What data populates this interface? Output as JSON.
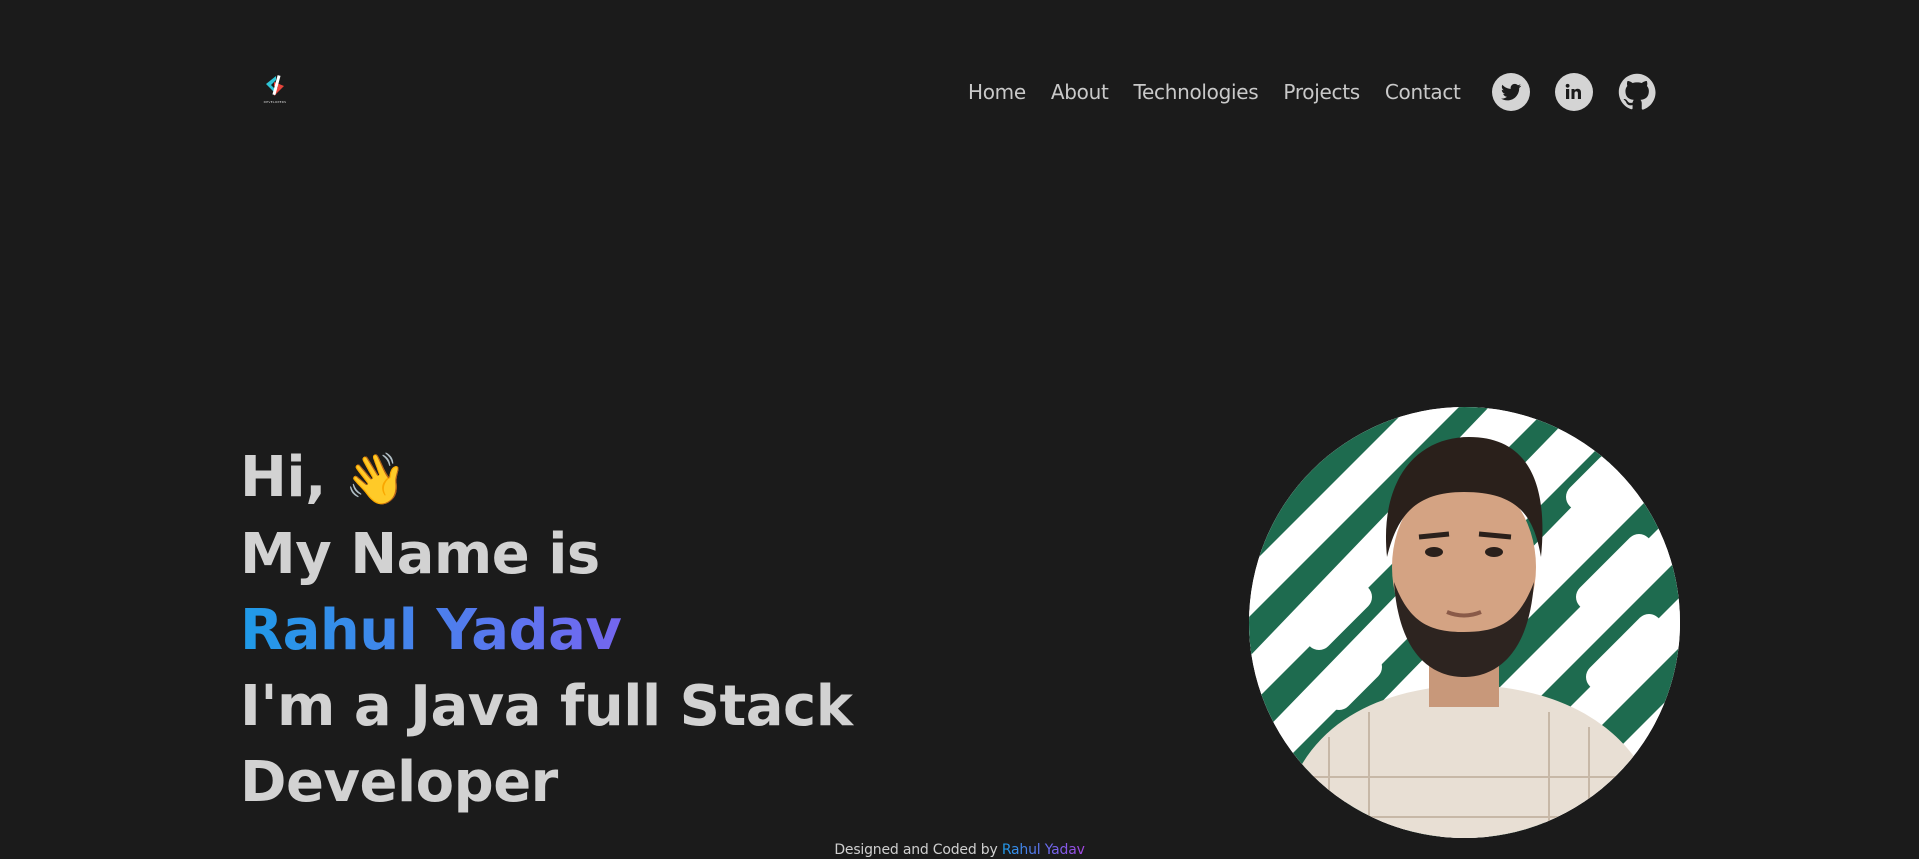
{
  "header": {
    "logo_text": "DEVELOPERS",
    "nav": [
      {
        "label": "Home"
      },
      {
        "label": "About"
      },
      {
        "label": "Technologies"
      },
      {
        "label": "Projects"
      },
      {
        "label": "Contact"
      }
    ],
    "socials": [
      {
        "name": "twitter-icon"
      },
      {
        "name": "linkedin-icon"
      },
      {
        "name": "github-icon"
      }
    ]
  },
  "hero": {
    "greeting": "Hi,",
    "wave_emoji": "👋",
    "intro": "My Name is",
    "name": "Rahul Yadav",
    "role_line1": "I'm a Java full Stack",
    "role_line2": "Developer"
  },
  "footer": {
    "prefix": "Designed and Coded by",
    "author": "Rahul Yadav"
  },
  "colors": {
    "background": "#1b1b1b",
    "text": "#d2d2d2",
    "gradient_start": "#1f9be8",
    "gradient_end": "#a545e0",
    "avatar_green": "#1e6b4f"
  }
}
